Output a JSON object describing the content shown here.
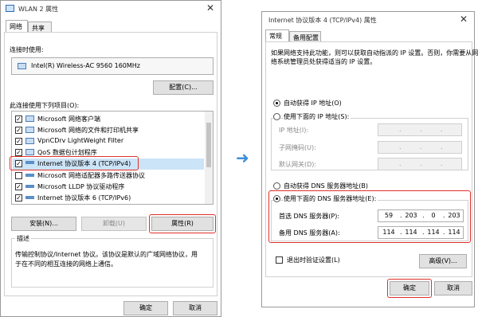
{
  "left": {
    "title": "WLAN 2 属性",
    "close": "✕",
    "tabs": [
      "网络",
      "共享"
    ],
    "connect_using_label": "连接时使用:",
    "adapter_name": "Intel(R) Wireless-AC 9560 160MHz",
    "configure_btn": "配置(C)...",
    "items_label": "此连接使用下列项目(O):",
    "items": [
      {
        "label": "Microsoft 网络客户端",
        "checked": true
      },
      {
        "label": "Microsoft 网络的文件和打印机共享",
        "checked": true
      },
      {
        "label": "VpnCDrv LightWeight Filter",
        "checked": true
      },
      {
        "label": "QoS 数据包计划程序",
        "checked": true
      },
      {
        "label": "Internet 协议版本 4 (TCP/IPv4)",
        "checked": true
      },
      {
        "label": "Microsoft 网络适配器多路传送器协议",
        "checked": false
      },
      {
        "label": "Microsoft LLDP 协议驱动程序",
        "checked": true
      },
      {
        "label": "Internet 协议版本 6 (TCP/IPv6)",
        "checked": true
      }
    ],
    "install_btn": "安装(N)...",
    "uninstall_btn": "卸载(U)",
    "properties_btn": "属性(R)",
    "desc_title": "描述",
    "desc_text_1": "传输控制协议/Internet 协议。该协议是默认的广域网络协议，用",
    "desc_text_2": "于在不同的相互连接的网络上通信。",
    "ok_btn": "确定",
    "cancel_btn": "取消"
  },
  "arrow": "➜",
  "right": {
    "title": "Internet 协议版本 4 (TCP/IPv4) 属性",
    "close": "✕",
    "tabs": [
      "常规",
      "备用配置"
    ],
    "intro_1": "如果网络支持此功能，则可以获取自动指派的 IP 设置。否则，你需要从网",
    "intro_2": "络系统管理员处获得适当的 IP 设置。",
    "auto_ip": "自动获得 IP 地址(O)",
    "use_ip": "使用下面的 IP 地址(S):",
    "ip_address_label": "IP 地址(I):",
    "subnet_label": "子网掩码(U):",
    "gateway_label": "默认网关(D):",
    "auto_dns": "自动获得 DNS 服务器地址(B)",
    "use_dns": "使用下面的 DNS 服务器地址(E):",
    "preferred_dns_label": "首选 DNS 服务器(P):",
    "preferred_dns": [
      "59",
      "203",
      "0",
      "203"
    ],
    "alternate_dns_label": "备用 DNS 服务器(A):",
    "alternate_dns": [
      "114",
      "114",
      "114",
      "114"
    ],
    "validate_label": "退出时验证设置(L)",
    "advanced_btn": "高级(V)...",
    "ok_btn": "确定",
    "cancel_btn": "取消"
  },
  "colors": {
    "highlight": "#e0302a",
    "arrow": "#3d8fd8",
    "selection": "#cce4f7"
  }
}
